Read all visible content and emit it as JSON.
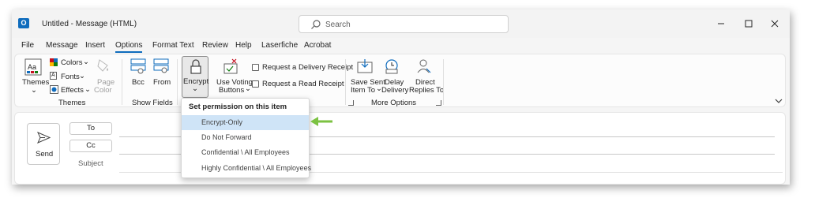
{
  "titlebar": {
    "title": "Untitled  -  Message (HTML)",
    "search_placeholder": "Search",
    "app_icon": "outlook-icon"
  },
  "menu": {
    "tabs": [
      "File",
      "Message",
      "Insert",
      "Options",
      "Format Text",
      "Review",
      "Help",
      "Laserfiche",
      "Acrobat"
    ],
    "active": "Options"
  },
  "ribbon": {
    "themes": {
      "themes_label": "Themes",
      "colors_label": "Colors",
      "fonts_label": "Fonts",
      "effects_label": "Effects",
      "page_color_label_1": "Page",
      "page_color_label_2": "Color",
      "group_label": "Themes"
    },
    "show_fields": {
      "bcc_label": "Bcc",
      "from_label": "From",
      "group_label": "Show Fields"
    },
    "permission": {
      "encrypt_label": "Encrypt"
    },
    "tracking": {
      "voting_label_1": "Use Voting",
      "voting_label_2": "Buttons",
      "delivery_receipt_label": "Request a Delivery Receipt",
      "read_receipt_label": "Request a Read Receipt"
    },
    "more_options": {
      "save_sent_1": "Save Sent",
      "save_sent_2": "Item To",
      "delay_1": "Delay",
      "delay_2": "Delivery",
      "direct_1": "Direct",
      "direct_2": "Replies To",
      "group_label": "More Options"
    }
  },
  "compose": {
    "send_label": "Send",
    "to_label": "To",
    "cc_label": "Cc",
    "subject_label": "Subject"
  },
  "dropdown": {
    "header": "Set permission on this item",
    "items": [
      "Encrypt-Only",
      "Do Not Forward",
      "Confidential \\ All Employees",
      "Highly Confidential \\ All Employees"
    ],
    "highlighted_index": 0
  },
  "colors": {
    "accent": "#0f6cbd",
    "highlight": "#cfe4f7",
    "arrow": "#7cc242"
  }
}
